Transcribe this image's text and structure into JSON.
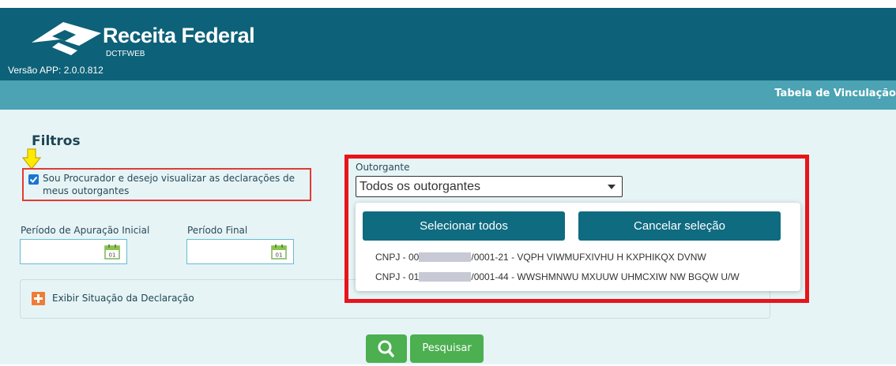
{
  "header": {
    "brand": "Receita Federal",
    "product": "DCTFWEB",
    "version": "Versão APP: 2.0.0.812"
  },
  "subbar": {
    "title": "Tabela de Vinculação"
  },
  "filters": {
    "title": "Filtros",
    "procurador_label": "Sou Procurador e desejo visualizar as declarações de meus outorgantes",
    "procurador_checked": true,
    "periodo_inicial_label": "Período de Apuração Inicial",
    "periodo_final_label": "Período Final",
    "calendar_day": "01",
    "situacao_label": "Exibir Situação da Declaração",
    "pesquisar_label": "Pesquisar"
  },
  "outorgante": {
    "label": "Outorgante",
    "selected": "Todos os outorgantes",
    "select_all_label": "Selecionar todos",
    "cancel_label": "Cancelar seleção",
    "options": [
      {
        "prefix": "CNPJ - 00",
        "suffix": "/0001-21 - VQPH VIWMUFXIVHU H KXPHIKQX DVNW"
      },
      {
        "prefix": "CNPJ - 01",
        "suffix": "/0001-44 - WWSHMNWU MXUUW UHMCXIW NW BGQW U/W"
      }
    ]
  },
  "colors": {
    "header_bg": "#0d6178",
    "subbar_bg": "#4ba3b4",
    "content_bg": "#e6f4f6",
    "button_blue": "#0f6b80",
    "button_green": "#4caf50",
    "highlight_red": "#e8141a"
  }
}
